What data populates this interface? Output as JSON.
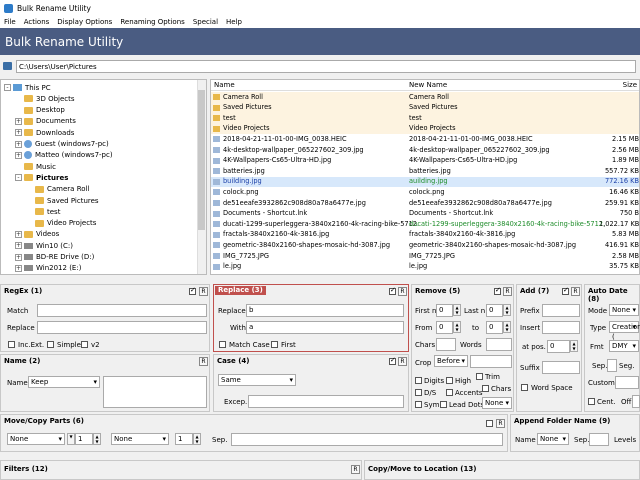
{
  "window": {
    "title": "Bulk Rename Utility"
  },
  "menu": [
    "File",
    "Actions",
    "Display Options",
    "Renaming Options",
    "Special",
    "Help"
  ],
  "banner": {
    "title": "Bulk Rename Utility"
  },
  "path": {
    "value": "C:\\Users\\User\\Pictures"
  },
  "tree": [
    {
      "label": "This PC",
      "indent": 0,
      "exp": "-",
      "icon": "pc"
    },
    {
      "label": "3D Objects",
      "indent": 1,
      "exp": "",
      "icon": "fold"
    },
    {
      "label": "Desktop",
      "indent": 1,
      "exp": "",
      "icon": "fold"
    },
    {
      "label": "Documents",
      "indent": 1,
      "exp": "+",
      "icon": "fold"
    },
    {
      "label": "Downloads",
      "indent": 1,
      "exp": "+",
      "icon": "fold"
    },
    {
      "label": "Guest (windows7-pc)",
      "indent": 1,
      "exp": "+",
      "icon": "usr"
    },
    {
      "label": "Matteo (windows7-pc)",
      "indent": 1,
      "exp": "+",
      "icon": "usr"
    },
    {
      "label": "Music",
      "indent": 1,
      "exp": "",
      "icon": "fold"
    },
    {
      "label": "Pictures",
      "indent": 1,
      "exp": "-",
      "icon": "fold",
      "bold": true
    },
    {
      "label": "Camera Roll",
      "indent": 2,
      "exp": "",
      "icon": "fold"
    },
    {
      "label": "Saved Pictures",
      "indent": 2,
      "exp": "",
      "icon": "fold"
    },
    {
      "label": "test",
      "indent": 2,
      "exp": "",
      "icon": "fold"
    },
    {
      "label": "Video Projects",
      "indent": 2,
      "exp": "",
      "icon": "fold"
    },
    {
      "label": "Videos",
      "indent": 1,
      "exp": "+",
      "icon": "fold"
    },
    {
      "label": "Win10 (C:)",
      "indent": 1,
      "exp": "+",
      "icon": "drv"
    },
    {
      "label": "BD-RE Drive (D:)",
      "indent": 1,
      "exp": "+",
      "icon": "drv"
    },
    {
      "label": "Win2012 (E:)",
      "indent": 1,
      "exp": "+",
      "icon": "drv"
    }
  ],
  "files": {
    "headers": {
      "name": "Name",
      "new_name": "New Name",
      "size": "Size"
    },
    "rows": [
      {
        "name": "Camera Roll",
        "new": "Camera Roll",
        "size": "",
        "type": "folder"
      },
      {
        "name": "Saved Pictures",
        "new": "Saved Pictures",
        "size": "",
        "type": "folder"
      },
      {
        "name": "test",
        "new": "test",
        "size": "",
        "type": "folder"
      },
      {
        "name": "Video Projects",
        "new": "Video Projects",
        "size": "",
        "type": "folder"
      },
      {
        "name": "2018-04-21-11-01-00-IMG_0038.HEIC",
        "new": "2018-04-21-11-01-00-IMG_0038.HEIC",
        "size": "2.15 MB",
        "type": "file"
      },
      {
        "name": "4k-desktop-wallpaper_065227602_309.jpg",
        "new": "4k-desktop-wallpaper_065227602_309.jpg",
        "size": "2.56 MB",
        "type": "file"
      },
      {
        "name": "4K-Wallpapers-Cs65-Ultra-HD.jpg",
        "new": "4K-Wallpapers-Cs65-Ultra-HD.jpg",
        "size": "1.89 MB",
        "type": "file"
      },
      {
        "name": "batteries.jpg",
        "new": "batteries.jpg",
        "size": "557.72 KB",
        "type": "file"
      },
      {
        "name": "building.jpg",
        "new": "auilding.jpg",
        "size": "772.16 KB",
        "type": "sel"
      },
      {
        "name": "colock.png",
        "new": "colock.png",
        "size": "16.46 KB",
        "type": "file"
      },
      {
        "name": "de51eeafe3932862c908d80a78a6477e.jpg",
        "new": "de51eeafe3932862c908d80a78a6477e.jpg",
        "size": "259.91 KB",
        "type": "file"
      },
      {
        "name": "Documents - Shortcut.lnk",
        "new": "Documents - Shortcut.lnk",
        "size": "750 B",
        "type": "file"
      },
      {
        "name": "ducati-1299-superleggera-3840x2160-4k-racing-bike-5712.j...",
        "new": "ducati-1299-superleggera-3840x2160-4k-racing-bike-5712.jpg",
        "size": "1,022.17 KB",
        "type": "file"
      },
      {
        "name": "fractals-3840x2160-4k-3816.jpg",
        "new": "fractals-3840x2160-4k-3816.jpg",
        "size": "5.83 MB",
        "type": "file"
      },
      {
        "name": "geometric-3840x2160-shapes-mosaic-hd-3087.jpg",
        "new": "geometric-3840x2160-shapes-mosaic-hd-3087.jpg",
        "size": "416.91 KB",
        "type": "file"
      },
      {
        "name": "IMG_7725.JPG",
        "new": "IMG_7725.JPG",
        "size": "2.58 MB",
        "type": "file"
      },
      {
        "name": "le.jpg",
        "new": "le.jpg",
        "size": "35.75 KB",
        "type": "file"
      },
      {
        "name": "...",
        "new": "...",
        "size": "",
        "type": "file"
      }
    ]
  },
  "regex": {
    "title": "RegEx (1)",
    "match_label": "Match",
    "replace_label": "Replace",
    "incext": "Inc.Ext.",
    "simple": "Simple",
    "v2": "v2",
    "r": "R"
  },
  "replace": {
    "title": "Replace (3)",
    "replace_label": "Replace",
    "replace_value": "b",
    "with_label": "With",
    "with_value": "a",
    "match_case": "Match Case",
    "first": "First",
    "r": "R"
  },
  "remove": {
    "title": "Remove (5)",
    "first_n": "First n",
    "first_n_val": "0",
    "last_n": "Last n",
    "last_n_val": "0",
    "from": "From",
    "from_val": "0",
    "to": "to",
    "to_val": "0",
    "chars": "Chars",
    "words": "Words",
    "crop": "Crop",
    "crop_val": "Before",
    "digits": "Digits",
    "high": "High",
    "trim": "Trim",
    "ds": "D/S",
    "accents": "Accents",
    "chars2": "Chars",
    "sym": "Sym.",
    "lead_dots": "Lead Dots",
    "none": "None",
    "r": "R"
  },
  "add": {
    "title": "Add (7)",
    "prefix": "Prefix",
    "insert": "Insert",
    "at_pos": "at pos.",
    "at_pos_val": "0",
    "suffix": "Suffix",
    "word_space": "Word Space",
    "r": "R"
  },
  "autodate": {
    "title": "Auto Date (8)",
    "mode": "Mode",
    "mode_val": "None",
    "type": "Type",
    "type_val": "Creation (",
    "fmt": "Fmt",
    "fmt_val": "DMY",
    "sep": "Sep.",
    "seg": "Seg.",
    "custom": "Custom",
    "cent": "Cent.",
    "off": "Off"
  },
  "name": {
    "title": "Name (2)",
    "name_label": "Name",
    "name_val": "Keep",
    "r": "R"
  },
  "case": {
    "title": "Case (4)",
    "case_val": "Same",
    "excep": "Excep.",
    "r": "R"
  },
  "movecopy": {
    "title": "Move/Copy Parts (6)",
    "a": "None",
    "n1": "1",
    "b": "None",
    "n2": "1",
    "sep": "Sep.",
    "r": "R"
  },
  "appendfolder": {
    "title": "Append Folder Name (9)",
    "name": "Name",
    "name_val": "None",
    "sep": "Sep.",
    "levels": "Levels"
  },
  "filters": {
    "title": "Filters (12)",
    "r": "R"
  },
  "copymove": {
    "title": "Copy/Move to Location (13)"
  }
}
